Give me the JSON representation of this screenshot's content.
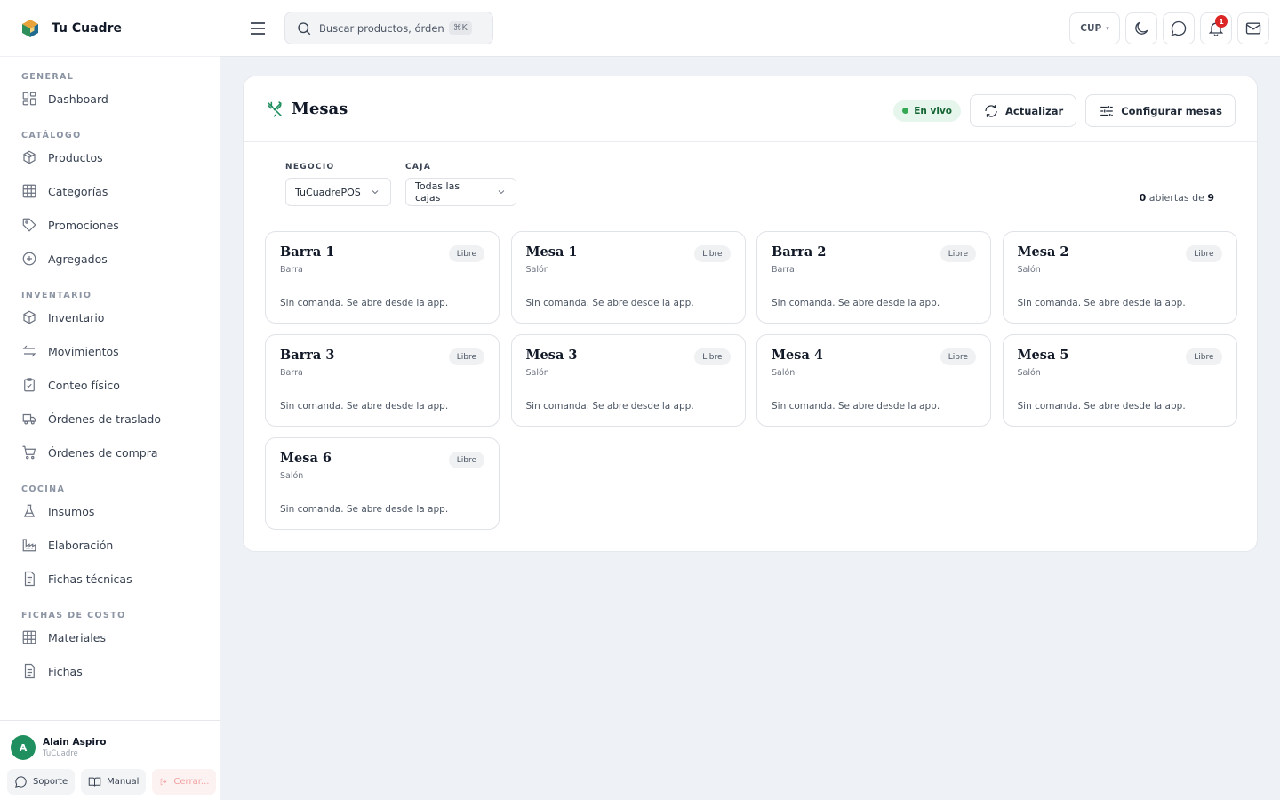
{
  "brand": {
    "name": "Tu Cuadre"
  },
  "sidebar": {
    "sections": [
      {
        "title": "GENERAL",
        "items": [
          {
            "label": "Dashboard",
            "icon": "dashboard-icon"
          }
        ]
      },
      {
        "title": "CATÁLOGO",
        "items": [
          {
            "label": "Productos",
            "icon": "box-icon"
          },
          {
            "label": "Categorías",
            "icon": "grid-icon"
          },
          {
            "label": "Promociones",
            "icon": "tag-icon"
          },
          {
            "label": "Agregados",
            "icon": "plus-circle-icon"
          }
        ]
      },
      {
        "title": "INVENTARIO",
        "items": [
          {
            "label": "Inventario",
            "icon": "box-icon"
          },
          {
            "label": "Movimientos",
            "icon": "arrows-icon"
          },
          {
            "label": "Conteo físico",
            "icon": "clipboard-icon"
          },
          {
            "label": "Órdenes de traslado",
            "icon": "truck-icon"
          },
          {
            "label": "Órdenes de compra",
            "icon": "cart-icon"
          }
        ]
      },
      {
        "title": "COCINA",
        "items": [
          {
            "label": "Insumos",
            "icon": "flask-icon"
          },
          {
            "label": "Elaboración",
            "icon": "factory-icon"
          },
          {
            "label": "Fichas técnicas",
            "icon": "document-icon"
          }
        ]
      },
      {
        "title": "FICHAS DE COSTO",
        "items": [
          {
            "label": "Materiales",
            "icon": "grid-icon"
          },
          {
            "label": "Fichas",
            "icon": "document-icon"
          }
        ]
      }
    ]
  },
  "user": {
    "initial": "A",
    "name": "Alain Aspiro",
    "org": "TuCuadre",
    "support_label": "Soporte",
    "manual_label": "Manual",
    "logout_label": "Cerrar..."
  },
  "topbar": {
    "search_placeholder": "Buscar productos, órdenes...",
    "search_shortcut": "⌘K",
    "currency": "CUP",
    "notifications_count": "1"
  },
  "page": {
    "title": "Mesas",
    "live_label": "En vivo",
    "refresh_label": "Actualizar",
    "configure_label": "Configurar mesas",
    "filters": {
      "business_label": "NEGOCIO",
      "business_value": "TuCuadrePOS",
      "register_label": "CAJA",
      "register_value": "Todas las cajas"
    },
    "summary": {
      "open": "0",
      "middle": " abiertas de ",
      "total": "9"
    },
    "tables": [
      {
        "name": "Barra 1",
        "zone": "Barra",
        "status": "Libre",
        "note": "Sin comanda. Se abre desde la app."
      },
      {
        "name": "Mesa 1",
        "zone": "Salón",
        "status": "Libre",
        "note": "Sin comanda. Se abre desde la app."
      },
      {
        "name": "Barra 2",
        "zone": "Barra",
        "status": "Libre",
        "note": "Sin comanda. Se abre desde la app."
      },
      {
        "name": "Mesa 2",
        "zone": "Salón",
        "status": "Libre",
        "note": "Sin comanda. Se abre desde la app."
      },
      {
        "name": "Barra 3",
        "zone": "Barra",
        "status": "Libre",
        "note": "Sin comanda. Se abre desde la app."
      },
      {
        "name": "Mesa 3",
        "zone": "Salón",
        "status": "Libre",
        "note": "Sin comanda. Se abre desde la app."
      },
      {
        "name": "Mesa 4",
        "zone": "Salón",
        "status": "Libre",
        "note": "Sin comanda. Se abre desde la app."
      },
      {
        "name": "Mesa 5",
        "zone": "Salón",
        "status": "Libre",
        "note": "Sin comanda. Se abre desde la app."
      },
      {
        "name": "Mesa 6",
        "zone": "Salón",
        "status": "Libre",
        "note": "Sin comanda. Se abre desde la app."
      }
    ]
  },
  "colors": {
    "accent": "#1f8f5f",
    "live_bg": "#e7f6ec",
    "badge": "#dc2626"
  }
}
